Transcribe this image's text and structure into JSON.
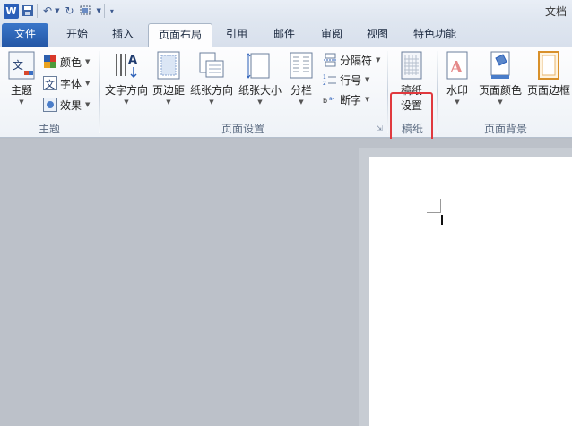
{
  "titlebar": {
    "app_icon": "W",
    "title": "文档"
  },
  "tabs": [
    {
      "label": "文件"
    },
    {
      "label": "开始"
    },
    {
      "label": "插入"
    },
    {
      "label": "页面布局"
    },
    {
      "label": "引用"
    },
    {
      "label": "邮件"
    },
    {
      "label": "审阅"
    },
    {
      "label": "视图"
    },
    {
      "label": "特色功能"
    }
  ],
  "ribbon": {
    "theme": {
      "themes_label": "主题",
      "colors_label": "颜色",
      "fonts_label": "字体",
      "effects_label": "效果",
      "group_label": "主题"
    },
    "page_setup": {
      "text_direction": "文字方向",
      "margins": "页边距",
      "orientation": "纸张方向",
      "size": "纸张大小",
      "columns": "分栏",
      "breaks": "分隔符",
      "line_numbers": "行号",
      "hyphenation": "断字",
      "group_label": "页面设置"
    },
    "manuscript": {
      "button_line1": "稿纸",
      "button_line2": "设置",
      "group_label": "稿纸"
    },
    "page_background": {
      "watermark": "水印",
      "page_color": "页面颜色",
      "page_borders": "页面边框",
      "group_label": "页面背景"
    }
  },
  "colors": {
    "accent": "#2b5fb8",
    "highlight": "#e0393e"
  }
}
